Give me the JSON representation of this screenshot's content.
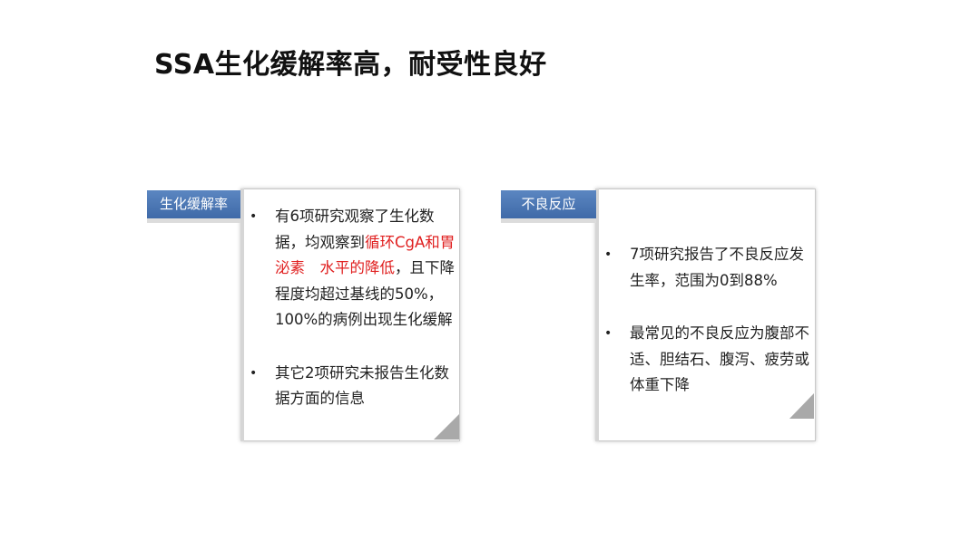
{
  "slide": {
    "title": "SSA生化缓解率高，耐受性良好"
  },
  "left_card": {
    "tab_label": "生化缓解率",
    "bullets": [
      {
        "before": "有6项研究观察了生化数据，均观察到",
        "highlight": "循环CgA和胃泌素　水平的降低",
        "after": "，且下降程度均超过基线的50%，100%的病例出现生化缓解"
      },
      {
        "text": "其它2项研究未报告生化数据方面的信息"
      }
    ]
  },
  "right_card": {
    "tab_label": "不良反应",
    "bullets": [
      {
        "text": "7项研究报告了不良反应发生率，范围为0到88%"
      },
      {
        "text": "最常见的不良反应为腹部不适、胆结石、腹泻、疲劳或体重下降"
      }
    ]
  },
  "bullet_symbol": "•",
  "colors": {
    "tab_blue": "#4a76b3",
    "highlight_red": "#e02020",
    "corner_gray": "#a9a9a9"
  }
}
